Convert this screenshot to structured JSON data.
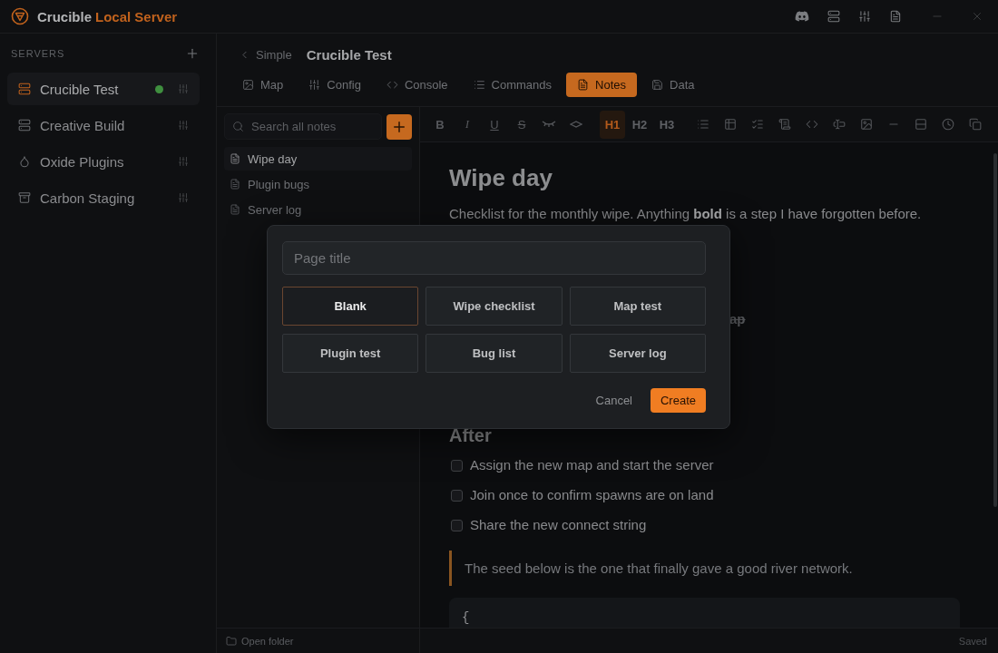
{
  "app": {
    "name": "Crucible",
    "suffix": "Local Server"
  },
  "sidebar": {
    "heading": "SERVERS",
    "servers": [
      {
        "name": "Crucible Test",
        "kind": "server",
        "selected": true,
        "running": true
      },
      {
        "name": "Creative Build",
        "kind": "server",
        "selected": false,
        "running": false
      },
      {
        "name": "Oxide Plugins",
        "kind": "drop",
        "selected": false,
        "running": false
      },
      {
        "name": "Carbon Staging",
        "kind": "archive",
        "selected": false,
        "running": false
      }
    ]
  },
  "breadcrumb": {
    "back": "Simple",
    "current": "Crucible Test"
  },
  "tabs": [
    {
      "label": "Map",
      "kind": "map",
      "selected": false
    },
    {
      "label": "Config",
      "kind": "config",
      "selected": false
    },
    {
      "label": "Console",
      "kind": "console",
      "selected": false
    },
    {
      "label": "Commands",
      "kind": "commands",
      "selected": false
    },
    {
      "label": "Notes",
      "kind": "notes",
      "selected": true
    },
    {
      "label": "Data",
      "kind": "data",
      "selected": false
    }
  ],
  "notes_panel": {
    "search": {
      "placeholder": "Search all notes"
    },
    "notes": [
      {
        "title": "Wipe day",
        "selected": true
      },
      {
        "title": "Plugin bugs",
        "selected": false
      },
      {
        "title": "Server log",
        "selected": false
      }
    ],
    "footer": "Open folder"
  },
  "toolbar": {
    "formats": [
      {
        "label": "B",
        "kind": "bold"
      },
      {
        "label": "I",
        "kind": "italic"
      },
      {
        "label": "U",
        "kind": "underline"
      },
      {
        "label": "S",
        "kind": "strike"
      }
    ],
    "headings": [
      {
        "label": "H1",
        "selected": true
      },
      {
        "label": "H2",
        "selected": false
      },
      {
        "label": "H3",
        "selected": false
      }
    ]
  },
  "editor": {
    "title": "Wipe day",
    "intro": "Checklist for the monthly wipe. Anything **bold** is a step I have forgotten before.",
    "partial_line": {
      "text": "ap",
      "struck": true
    },
    "section": "After",
    "tasks": [
      {
        "text": "Assign the new map and start the server",
        "checked": false
      },
      {
        "text": "Join once to confirm spawns are on land",
        "checked": false
      },
      {
        "text": "Share the new connect string",
        "checked": false
      }
    ],
    "quote": "The seed below is the one that finally gave a good river network.",
    "code": "{"
  },
  "status": "Saved",
  "dialog": {
    "input": {
      "placeholder": "Page title"
    },
    "templates": [
      {
        "label": "Blank",
        "selected": true
      },
      {
        "label": "Wipe checklist",
        "selected": false
      },
      {
        "label": "Map test",
        "selected": false
      },
      {
        "label": "Plugin test",
        "selected": false
      },
      {
        "label": "Bug list",
        "selected": false
      },
      {
        "label": "Server log",
        "selected": false
      }
    ],
    "cancel": "Cancel",
    "confirm": "Create"
  }
}
